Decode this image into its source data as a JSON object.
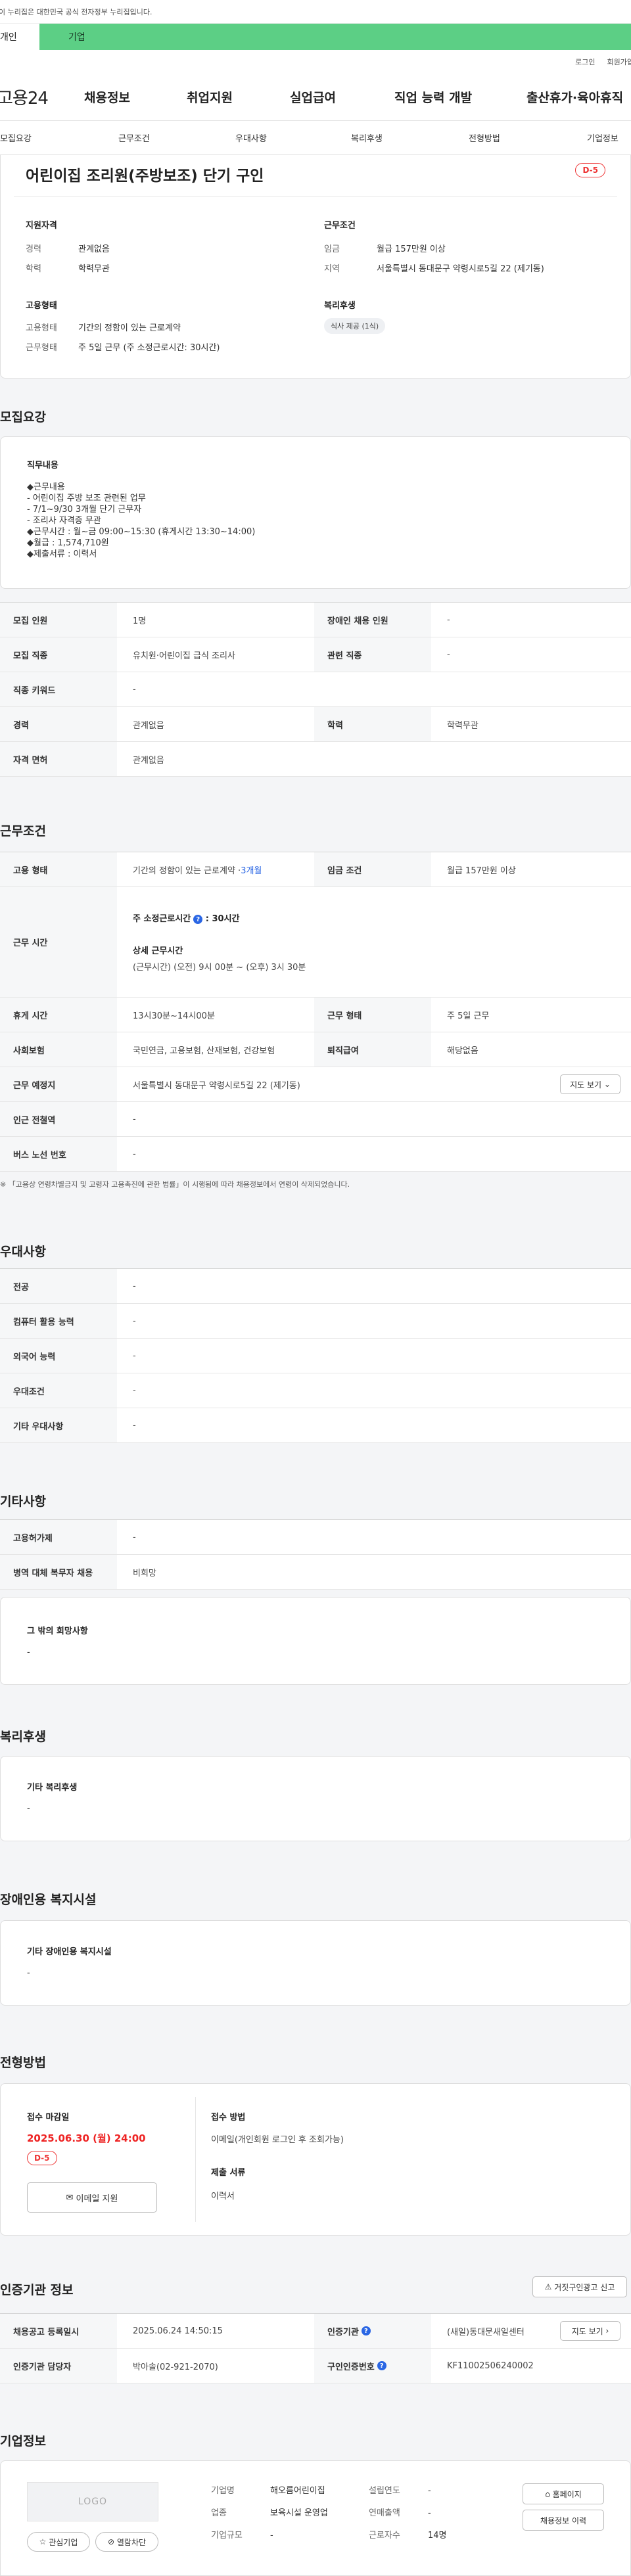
{
  "gov_banner": "이 누리집은 대한민국 공식 전자정부 누리집입니다.",
  "type_tabs": {
    "personal": "개인",
    "company": "기업"
  },
  "util": {
    "login": "로그인",
    "signup": "회원가입"
  },
  "logo": "고용24",
  "main_nav": [
    "채용정보",
    "취업지원",
    "실업급여",
    "직업 능력 개발",
    "출산휴가·육아휴직"
  ],
  "sub_nav": [
    "모집요강",
    "근무조건",
    "우대사항",
    "복리후생",
    "전형방법",
    "기업정보"
  ],
  "job": {
    "title": "어린이집 조리원(주방보조) 단기 구인",
    "dday": "D-5",
    "qual_title": "지원자격",
    "career_label": "경력",
    "career_value": "관계없음",
    "edu_label": "학력",
    "edu_value": "학력무관",
    "cond_title": "근무조건",
    "wage_label": "임금",
    "wage_value": "월급 157만원 이상",
    "area_label": "지역",
    "area_value": "서울특별시 동대문구 약령시로5길 22 (제기동)",
    "emp_title": "고용형태",
    "emp_type_label": "고용형태",
    "emp_type_value": "기간의 정함이 있는 근로계약",
    "work_type_label": "근무형태",
    "work_type_value": "주 5일 근무 (주 소정근로시간: 30시간)",
    "welfare_title": "복리후생",
    "welfare_chip": "식사 제공 (1식)"
  },
  "recruit": {
    "title": "모집요강",
    "duty_title": "직무내용",
    "duty_lines": [
      "◆근무내용",
      "- 어린이집 주방 보조 관련된 업무",
      "- 7/1~9/30 3개월 단기 근무자",
      "- 조리사 자격증 무관",
      "◆근무시간 : 월~금 09:00~15:30 (휴게시간 13:30~14:00)",
      "◆월급 : 1,574,710원",
      "◆제출서류 : 이력서"
    ],
    "rows": [
      {
        "k1": "모집 인원",
        "v1": "1명",
        "k2": "장애인 채용 인원",
        "v2": "-"
      },
      {
        "k1": "모집 직종",
        "v1": "유치원·어린이집 급식 조리사",
        "k2": "관련 직종",
        "v2": "-"
      },
      {
        "k1": "직종 키워드",
        "v1": "-"
      },
      {
        "k1": "경력",
        "v1": "관계없음",
        "k2": "학력",
        "v2": "학력무관"
      },
      {
        "k1": "자격 면허",
        "v1": "관계없음"
      }
    ]
  },
  "work": {
    "title": "근무조건",
    "emp_type_label": "고용 형태",
    "emp_type_value": "기간의 정함이 있는 근로계약 · ",
    "emp_period": "3개월",
    "wage_label": "임금 조건",
    "wage_value": "월급 157만원 이상",
    "time_label": "근무 시간",
    "weekly_hours_label": "주 소정근로시간",
    "weekly_hours_value": ": 30시간",
    "detail_label": "상세 근무시간",
    "detail_value": "(근무시간) (오전) 9시 00분 ~ (오후) 3시 30분",
    "break_label": "휴게 시간",
    "break_value": "13시30분~14시00분",
    "form_label": "근무 형태",
    "form_value": "주 5일 근무",
    "ins_label": "사회보험",
    "ins_value": "국민연금, 고용보험, 산재보험, 건강보험",
    "sev_label": "퇴직급여",
    "sev_value": "해당없음",
    "place_label": "근무 예정지",
    "place_value": "서울특별시 동대문구 약령시로5길 22 (제기동)",
    "map_btn": "지도 보기",
    "subway_label": "인근 전철역",
    "subway_value": "-",
    "bus_label": "버스 노선 번호",
    "bus_value": "-",
    "note": "※ 「고용상 연령차별금지 및 고령자 고용촉진에 관한 법률」이 시행됨에 따라 채용정보에서 연령이 삭제되었습니다."
  },
  "pref": {
    "title": "우대사항",
    "rows": [
      {
        "k": "전공",
        "v": "-"
      },
      {
        "k": "컴퓨터 활용 능력",
        "v": "-"
      },
      {
        "k": "외국어 능력",
        "v": "-"
      },
      {
        "k": "우대조건",
        "v": "-"
      },
      {
        "k": "기타 우대사항",
        "v": "-"
      }
    ]
  },
  "etc": {
    "title": "기타사항",
    "rows": [
      {
        "k": "고용허가제",
        "v": "-"
      },
      {
        "k": "병역 대체 복무자 채용",
        "v": "비희망"
      }
    ],
    "other_title": "그 밖의 희망사항",
    "other_value": "-"
  },
  "welfare": {
    "title": "복리후생",
    "sub_title": "기타 복리후생",
    "sub_value": "-"
  },
  "disabled": {
    "title": "장애인용 복지시설",
    "sub_title": "기타 장애인용 복지시설",
    "sub_value": "-"
  },
  "process": {
    "title": "전형방법",
    "deadline_label": "접수 마감일",
    "deadline_value": "2025.06.30 (월) 24:00",
    "dday": "D-5",
    "email_btn": "이메일 지원",
    "method_label": "접수 방법",
    "method_value": "이메일(개인회원 로그인 후 조회가능)",
    "docs_label": "제출 서류",
    "docs_value": "이력서"
  },
  "cert": {
    "title": "인증기관 정보",
    "report_btn": "거짓구인광고 신고",
    "reg_label": "채용공고 등록일시",
    "reg_value": "2025.06.24 14:50:15",
    "org_label": "인증기관",
    "org_value": "(새일)동대문새일센터",
    "map_btn": "지도 보기",
    "mgr_label": "인증기관 담당자",
    "mgr_value": "박아솔(02-921-2070)",
    "num_label": "구인인증번호",
    "num_value": "KF11002506240002"
  },
  "company": {
    "title": "기업정보",
    "logo_text": "LOGO",
    "interest_btn": "관심기업",
    "block_btn": "열람차단",
    "name_label": "기업명",
    "name_value": "해오름어린이집",
    "industry_label": "업종",
    "industry_value": "보육시설 운영업",
    "size_label": "기업규모",
    "size_value": "-",
    "founded_label": "설립연도",
    "founded_value": "-",
    "revenue_label": "연매출액",
    "revenue_value": "-",
    "emp_label": "근로자수",
    "emp_value": "14명",
    "home_btn": "홈페이지",
    "jobs_btn": "채용정보 이력"
  }
}
